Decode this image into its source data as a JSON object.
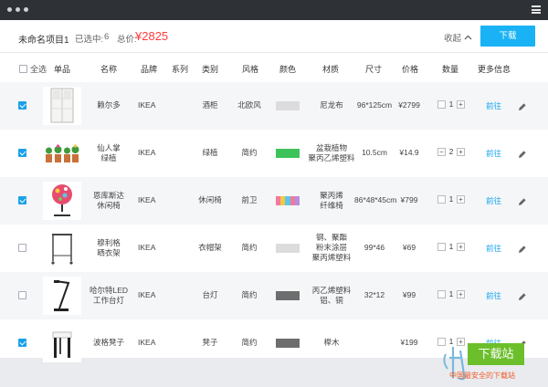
{
  "header": {
    "project_title": "未命名项目1",
    "selected_label": "已选中:",
    "selected_count": "6",
    "total_label": "总价:",
    "total_value": "¥2825",
    "collapse_label": "收起",
    "download_label": "下载"
  },
  "columns": {
    "select_all": "全选",
    "item": "单品",
    "name": "名称",
    "brand": "品牌",
    "series": "系列",
    "category": "类别",
    "style": "风格",
    "color": "颜色",
    "material": "材质",
    "size": "尺寸",
    "price": "价格",
    "quantity": "数量",
    "more_info": "更多信息"
  },
  "rows": [
    {
      "checked": true,
      "name": "赖尔多",
      "brand": "IKEA",
      "category": "酒柜",
      "style": "北欧风",
      "colors": [
        "#dcdcdc"
      ],
      "material": "尼龙布",
      "size": "96*125cm",
      "price": "¥2799",
      "qty": "1",
      "link": "前往",
      "thumb": "cabinet"
    },
    {
      "checked": true,
      "name": "仙人掌\n绿植",
      "brand": "IKEA",
      "category": "绿植",
      "style": "简约",
      "colors": [
        "#3dc35a"
      ],
      "material": "盆栽植物\n聚丙乙烯塑料",
      "size": "10.5cm",
      "price": "¥14.9",
      "qty": "2",
      "link": "前往",
      "thumb": "plants"
    },
    {
      "checked": true,
      "name": "恩库斯达\n休闲椅",
      "brand": "IKEA",
      "category": "休闲椅",
      "style": "前卫",
      "colors": [
        "#f07a9a",
        "#f5c842",
        "#5ec6e8",
        "#f07a9a",
        "#b68ee0"
      ],
      "material": "聚丙烯\n纤维椅",
      "size": "86*48*45cm",
      "price": "¥799",
      "qty": "1",
      "link": "前往",
      "thumb": "chair"
    },
    {
      "checked": false,
      "name": "穆利格\n晒衣架",
      "brand": "IKEA",
      "category": "衣帽架",
      "style": "简约",
      "colors": [
        "#dcdcdc"
      ],
      "material": "钢、聚酯\n粉末涂层\n聚丙烯塑料",
      "size": "99*46",
      "price": "¥69",
      "qty": "1",
      "link": "前往",
      "thumb": "rack"
    },
    {
      "checked": false,
      "name": "哈尔特LED\n工作台灯",
      "brand": "IKEA",
      "category": "台灯",
      "style": "简约",
      "colors": [
        "#6e6e6e"
      ],
      "material": "丙乙烯塑料\n铝、铜",
      "size": "32*12",
      "price": "¥99",
      "qty": "1",
      "link": "前往",
      "thumb": "lamp"
    },
    {
      "checked": true,
      "name": "波格凳子",
      "brand": "IKEA",
      "category": "凳子",
      "style": "简约",
      "colors": [
        "#6e6e6e"
      ],
      "material": "榉木",
      "size": "",
      "price": "¥199",
      "qty": "1",
      "link": "前往",
      "thumb": "stool"
    }
  ],
  "watermark": {
    "box_text": "下载站",
    "tagline": "中国最安全的下载站"
  },
  "icons": [
    "window-dots-icon",
    "menu-icon",
    "chevron-up-icon",
    "checkbox-icon",
    "minus-icon",
    "plus-icon",
    "pencil-icon"
  ]
}
